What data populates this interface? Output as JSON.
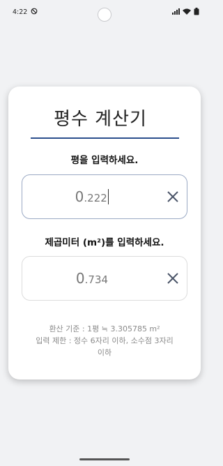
{
  "status_bar": {
    "time": "4:22"
  },
  "calculator": {
    "title": "평수 계산기",
    "pyeong": {
      "label": "평을 입력하세요.",
      "value_int": "0",
      "value_frac": ".222"
    },
    "sqm": {
      "label": "제곱미터 (m²)를 입력하세요.",
      "value_int": "0",
      "value_frac": ".734"
    },
    "footer_line1": "환산 기준 : 1평 ≒ 3.305785 m²",
    "footer_line2": "입력 제한 : 정수 6자리 이하, 소수점 3자리",
    "footer_line3": "이하"
  },
  "colors": {
    "accent": "#2b4e8c",
    "icon": "#4a5468"
  }
}
